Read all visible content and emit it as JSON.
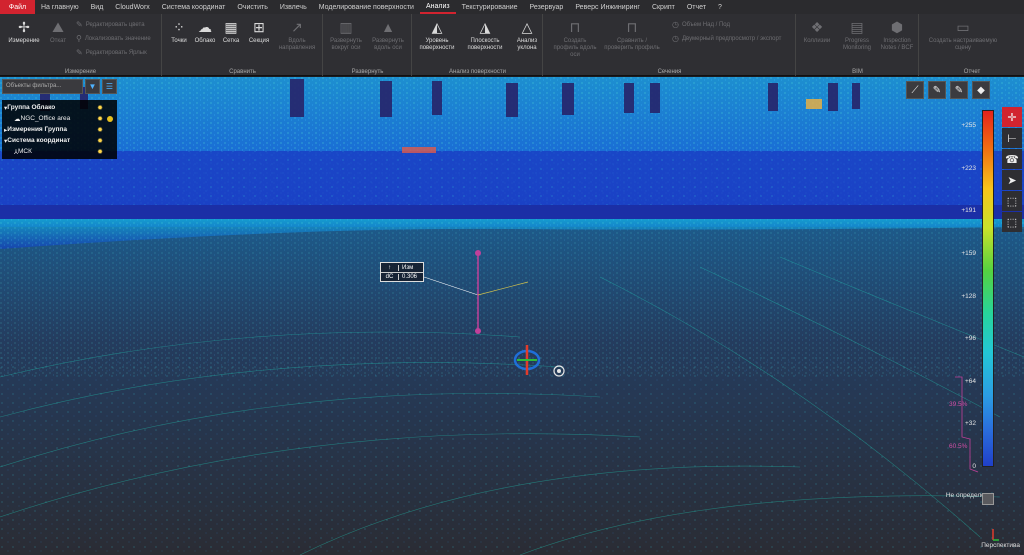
{
  "menu": {
    "file": "Файл",
    "items": [
      "На главную",
      "Вид",
      "CloudWorx",
      "Система координат",
      "Очистить",
      "Извлечь",
      "Моделирование поверхности",
      "Анализ",
      "Текстурирование",
      "Резервуар",
      "Реверс Инжиниринг",
      "Скрипт",
      "Отчет",
      "?"
    ],
    "active_index": 7
  },
  "ribbon": {
    "measure": {
      "label": "Измерение",
      "big": [
        {
          "label": "Измерение",
          "icon": "measure-icon"
        },
        {
          "label": "Откат",
          "icon": "rollback-icon"
        }
      ],
      "small": [
        "Редактировать цвета",
        "Локализовать значение",
        "Редактировать Ярлык"
      ]
    },
    "compare": {
      "label": "Сравнить",
      "buttons": [
        {
          "label": "Точки",
          "icon": "points-icon"
        },
        {
          "label": "Облако",
          "icon": "cloud-icon"
        },
        {
          "label": "Сетка",
          "icon": "mesh-icon"
        },
        {
          "label": "Секция",
          "icon": "section-icon"
        },
        {
          "label": "Вдоль направления",
          "icon": "direction-icon"
        }
      ]
    },
    "unroll": {
      "label": "Развернуть",
      "buttons": [
        {
          "label": "Развернуть вокруг оси",
          "icon": "unroll-axis-icon"
        },
        {
          "label": "Развернуть вдоль оси",
          "icon": "unroll-along-icon"
        }
      ]
    },
    "surface": {
      "label": "Анализ поверхности",
      "buttons": [
        {
          "label": "Уровень поверхности",
          "icon": "surface-level-icon"
        },
        {
          "label": "Плоскость поверхности",
          "icon": "surface-plane-icon"
        },
        {
          "label": "Анализ уклона",
          "icon": "slope-icon"
        }
      ]
    },
    "sections": {
      "label": "Сечения",
      "buttons": [
        {
          "label": "Создать профиль вдоль оси",
          "icon": "profile-axis-icon"
        },
        {
          "label": "Сравнить / проверить профиль",
          "icon": "profile-compare-icon"
        }
      ],
      "small": [
        "Объем Над / Под",
        "Двумерный предпросмотр / экспорт"
      ]
    },
    "bim": {
      "label": "BIM",
      "buttons": [
        {
          "label": "Коллизии",
          "icon": "collision-icon"
        },
        {
          "label": "Progress Monitoring",
          "icon": "progress-icon"
        },
        {
          "label": "Inspection Notes / BCF",
          "icon": "inspection-icon"
        }
      ]
    },
    "report": {
      "label": "Отчет",
      "buttons": [
        {
          "label": "Создать настраиваемую сцену",
          "icon": "report-icon"
        }
      ]
    }
  },
  "tree": {
    "filter_placeholder": "Объекты фильтра...",
    "rows": [
      {
        "label": "Группа Облако",
        "bold": true,
        "indent": 0
      },
      {
        "label": "NGC_Office area",
        "bold": false,
        "indent": 1
      },
      {
        "label": "Измерения Группа",
        "bold": true,
        "indent": 0
      },
      {
        "label": "Система координат",
        "bold": true,
        "indent": 0
      },
      {
        "label": "МСК",
        "bold": false,
        "indent": 1
      }
    ]
  },
  "measurement": {
    "row1_key": "↑",
    "row1_val": "Изм",
    "row2_key": "dC",
    "row2_val": "0.306"
  },
  "scale": {
    "ticks": [
      "+255",
      "+223",
      "+191",
      "+159",
      "+128",
      "+96",
      "+64",
      "+32",
      "0"
    ],
    "percent_labels": [
      "39.5%",
      "60.5%"
    ],
    "undefined_label": "Не определено",
    "colors": [
      "#e3231b",
      "#f6c51b",
      "#55d240",
      "#23c7d6",
      "#2040c8"
    ]
  },
  "viewport": {
    "projection": "Перспектива"
  }
}
